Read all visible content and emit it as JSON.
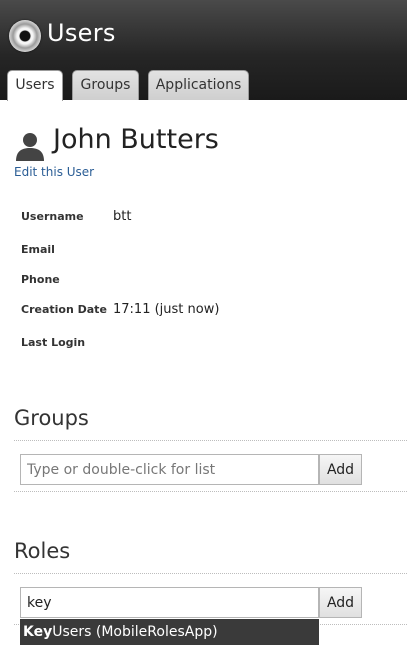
{
  "app": {
    "title": "Users"
  },
  "tabs": [
    {
      "label": "Users",
      "active": true
    },
    {
      "label": "Groups",
      "active": false
    },
    {
      "label": "Applications",
      "active": false
    }
  ],
  "user": {
    "name": "John Butters",
    "edit_label": "Edit this User",
    "icon": "user-silhouette-icon"
  },
  "fields": [
    {
      "label": "Username",
      "value": "btt"
    },
    {
      "label": "Email",
      "value": ""
    },
    {
      "label": "Phone",
      "value": ""
    },
    {
      "label": "Creation Date",
      "value": "17:11 (just now)"
    },
    {
      "label": "Last Login",
      "value": ""
    }
  ],
  "groups": {
    "title": "Groups",
    "input_value": "",
    "placeholder": "Type or double-click for list",
    "add_label": "Add"
  },
  "roles": {
    "title": "Roles",
    "input_value": "key",
    "placeholder": "",
    "add_label": "Add",
    "suggestion": {
      "match": "Key",
      "rest": "Users (MobileRolesApp)"
    }
  },
  "colors": {
    "header_bg": "#262626",
    "link": "#2a5d95",
    "autocomplete_bg": "#3a3a3a"
  }
}
